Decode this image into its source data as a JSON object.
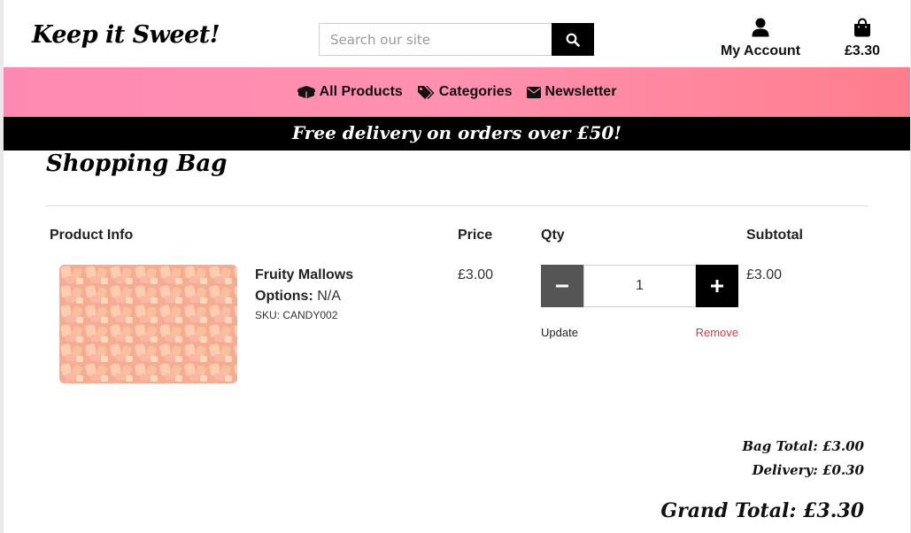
{
  "header": {
    "logo": "Keep it Sweet!",
    "search_placeholder": "Search our site",
    "account_label": "My Account",
    "bag_total": "£3.30"
  },
  "nav": {
    "all_products": "All Products",
    "categories": "Categories",
    "newsletter": "Newsletter"
  },
  "banner": "Free delivery on orders over £50!",
  "page_title": "Shopping Bag",
  "columns": {
    "product_info": "Product Info",
    "price": "Price",
    "qty": "Qty",
    "subtotal": "Subtotal"
  },
  "item": {
    "name": "Fruity Mallows",
    "options_label": "Options:",
    "options_value": "N/A",
    "sku": "SKU: CANDY002",
    "price": "£3.00",
    "qty": "1",
    "subtotal": "£3.00",
    "update_label": "Update",
    "remove_label": "Remove"
  },
  "totals": {
    "bag_total": "Bag Total: £3.00",
    "delivery": "Delivery: £0.30",
    "grand_total": "Grand Total: £3.30"
  },
  "colors": {
    "nav_gradient_start": "#ff89b2",
    "nav_gradient_end": "#ff7d8c",
    "remove_link": "#d93a4a",
    "banner_bg": "#000000"
  }
}
